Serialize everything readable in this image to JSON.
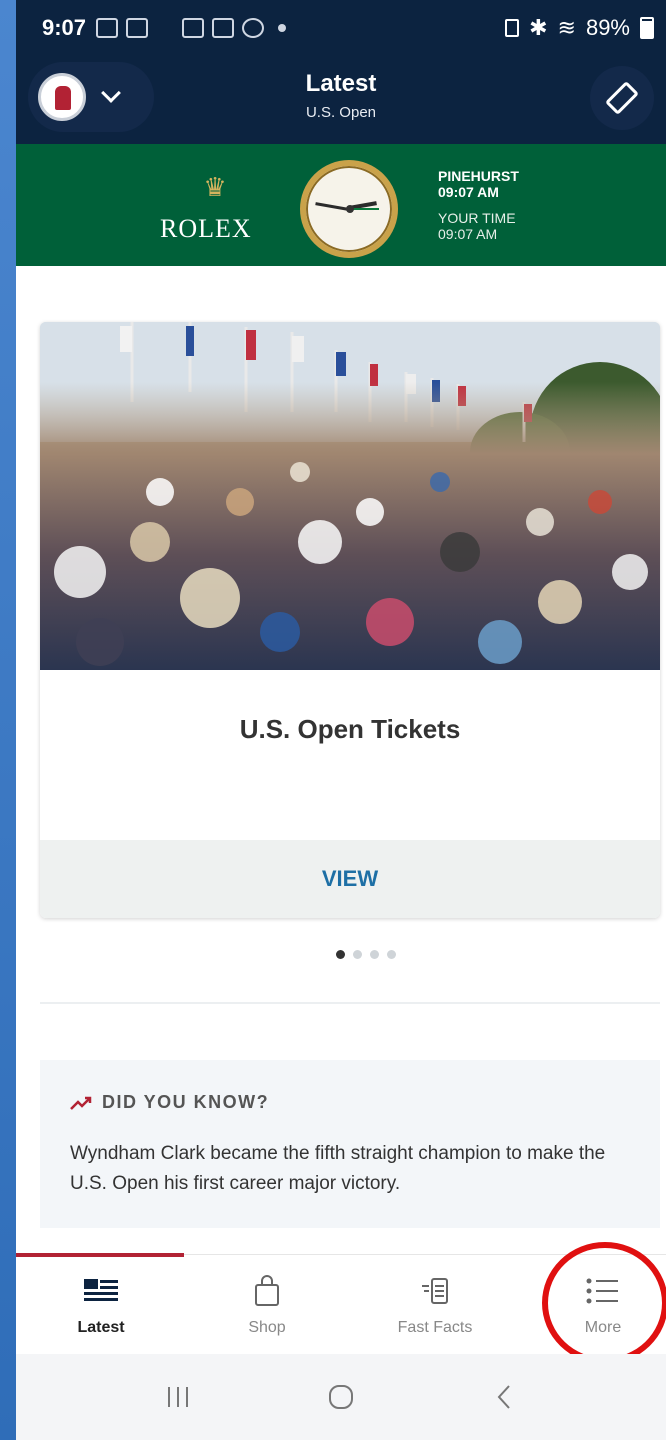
{
  "status_bar": {
    "time": "9:07",
    "battery": "89%",
    "battery_level": 0.89
  },
  "header": {
    "title": "Latest",
    "subtitle": "U.S. Open"
  },
  "rolex": {
    "brand": "ROLEX",
    "location_label": "PINEHURST",
    "location_time": "09:07 AM",
    "your_time_label": "YOUR TIME",
    "your_time": "09:07 AM"
  },
  "card": {
    "title": "U.S. Open Tickets",
    "action_label": "VIEW",
    "carousel_pages": 4,
    "active_page": 1
  },
  "did_you_know": {
    "title": "DID YOU KNOW?",
    "text": "Wyndham Clark became the fifth straight champion to make the U.S. Open his first career major victory."
  },
  "bottom_nav": {
    "items": [
      {
        "label": "Latest",
        "icon": "news-icon",
        "active": true
      },
      {
        "label": "Shop",
        "icon": "shopping-bag-icon",
        "active": false
      },
      {
        "label": "Fast Facts",
        "icon": "fast-facts-icon",
        "active": false
      },
      {
        "label": "More",
        "icon": "list-icon",
        "active": false
      }
    ]
  },
  "colors": {
    "navy": "#0c2340",
    "rolex_green": "#006039",
    "accent_red": "#b22234",
    "link_blue": "#1d6fa5",
    "highlight_red": "#e01010"
  }
}
